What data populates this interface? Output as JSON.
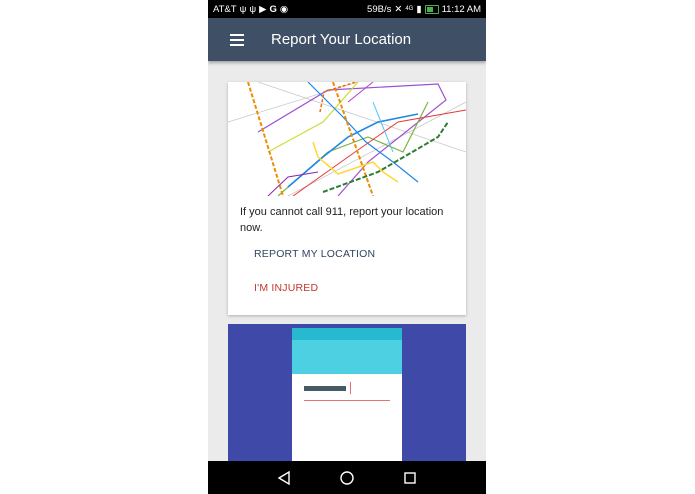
{
  "status_bar": {
    "carrier": "AT&T",
    "speed": "59B/s",
    "network": "4G",
    "time": "11:12 AM"
  },
  "app_bar": {
    "title": "Report Your Location"
  },
  "location_card": {
    "message": "If you cannot call 911, report your location now.",
    "report_action": "REPORT MY LOCATION",
    "injured_action": "I'M INJURED"
  },
  "colors": {
    "app_bar": "#3f4f66",
    "report_action": "#2f4560",
    "injured_action": "#c0392b",
    "second_card_bg": "#3f4aa8",
    "mock_header": "#4dd0e1"
  },
  "nav_bar": {
    "back_icon": "back-triangle-icon",
    "home_icon": "home-circle-icon",
    "recents_icon": "recents-square-icon"
  }
}
